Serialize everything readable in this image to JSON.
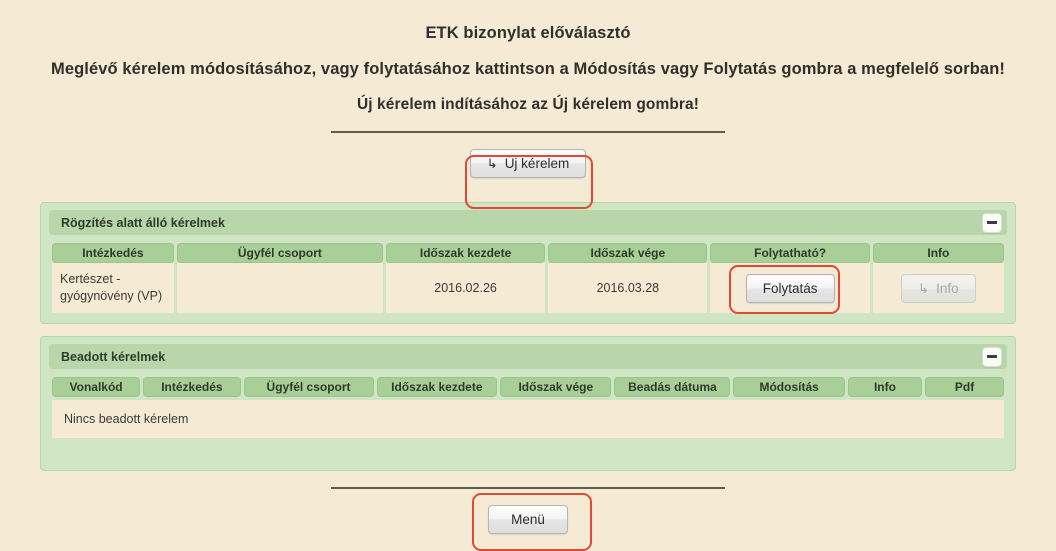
{
  "header": {
    "title": "ETK bizonylat előválasztó",
    "subtitle_1": "Meglévő kérelem módosításához, vagy folytatásához kattintson a Módosítás vagy Folytatás gombra a megfelelő sorban!",
    "subtitle_2": "Új kérelem indításához az Új kérelem gombra!"
  },
  "new_request_button": {
    "label": "Új kérelem",
    "icon": "arrow-enter-icon",
    "icon_glyph": "↳"
  },
  "panels": [
    {
      "id": "in-progress",
      "title": "Rögzítés alatt álló kérelmek",
      "collapse_icon": "minus-icon",
      "columns": [
        "Intézkedés",
        "Ügyfél csoport",
        "Időszak kezdete",
        "Időszak vége",
        "Folytatható?",
        "Info"
      ],
      "rows": [
        {
          "intezkedes": "Kertészet - gyógynövény (VP)",
          "ugyfel_csoport": "",
          "idoszak_kezdete": "2016.02.26",
          "idoszak_vege": "2016.03.28",
          "folytathato_label": "Folytatás",
          "info_label": "Info",
          "info_icon": "arrow-enter-icon",
          "info_icon_glyph": "↳",
          "info_disabled": true
        }
      ]
    },
    {
      "id": "submitted",
      "title": "Beadott kérelmek",
      "collapse_icon": "minus-icon",
      "columns": [
        "Vonalkód",
        "Intézkedés",
        "Ügyfél csoport",
        "Időszak kezdete",
        "Időszak vége",
        "Beadás dátuma",
        "Módosítás",
        "Info",
        "Pdf"
      ],
      "empty_message": "Nincs beadott kérelem"
    }
  ],
  "menu_button": {
    "label": "Menü"
  },
  "colors": {
    "page_background": "#f5ebd4",
    "panel_background": "#cfe5c4",
    "panel_header": "#b9d6ab",
    "table_header": "#a8cf98",
    "annotation": "#e04a33",
    "text": "#3a3a36"
  }
}
